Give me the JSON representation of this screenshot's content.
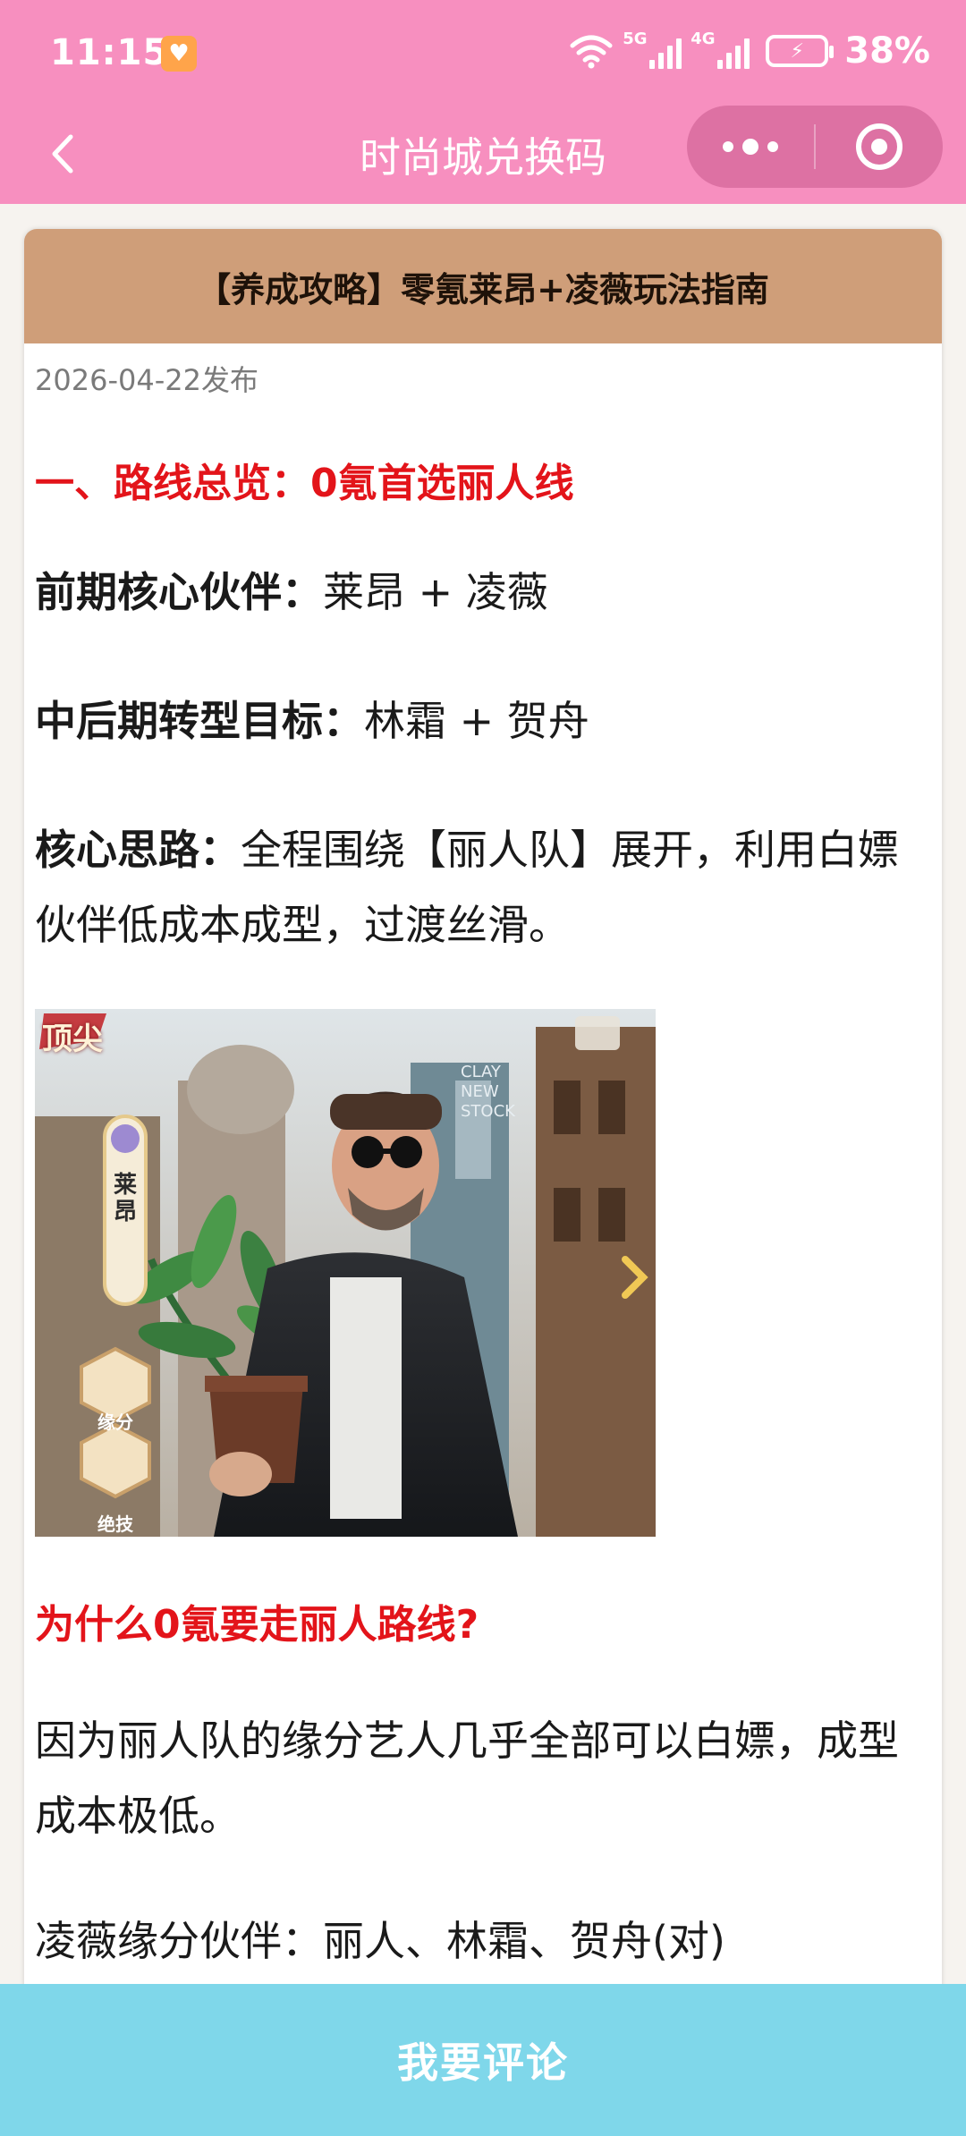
{
  "status_bar": {
    "time": "11:15",
    "net_5g": "5G",
    "net_4g": "4G",
    "battery": "38%",
    "icons": [
      "notification-app-icon",
      "wifi-icon",
      "signal-5g-icon",
      "signal-4g-icon",
      "battery-charging-icon"
    ]
  },
  "nav": {
    "title": "时尚城兑换码",
    "back_icon": "back-chevron-icon",
    "more_icon": "more-dots-icon",
    "close_icon": "target-close-icon"
  },
  "article": {
    "title": "【养成攻略】零氪莱昂+凌薇玩法指南",
    "date": "2026-04-22发布",
    "section1_heading": "一、路线总览：0氪首选丽人线",
    "line1_label": "前期核心伙伴：",
    "line1_value": "莱昂 + 凌薇",
    "line2_label": "中后期转型目标：",
    "line2_value": "林霜 + 贺舟",
    "line3_label": "核心思路：",
    "line3_value": "全程围绕【丽人队】展开，利用白嫖伙伴低成本成型，过渡丝滑。",
    "image": {
      "rank_badge": "顶尖",
      "name_tag": "莱昂",
      "button_fate": "缘分",
      "button_skill": "绝技",
      "sign_text": "CLAY NEW STOCK"
    },
    "question_heading": "为什么0氪要走丽人路线?",
    "answer_text": "因为丽人队的缘分艺人几乎全部可以白嫖，成型成本极低。",
    "cut_text": "凌薇缘分伙伴：丽人、林霜、贺舟(对)"
  },
  "footer": {
    "comment_label": "我要评论"
  },
  "colors": {
    "header_pink": "#f78fbf",
    "card_head_tan": "#cf9e79",
    "heading_red": "#e3141a",
    "footer_cyan": "#7fd7ea"
  }
}
